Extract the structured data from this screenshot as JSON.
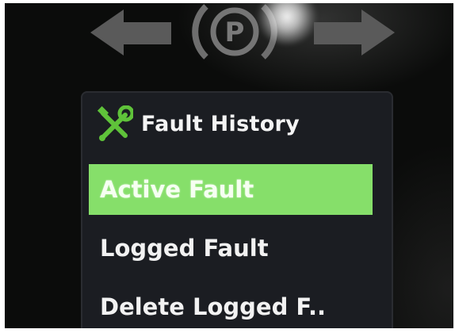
{
  "indicators": {
    "left_arrow": "left-arrow-icon",
    "park_brake": "parking-brake-icon",
    "park_brake_letter": "P",
    "right_arrow": "right-arrow-icon"
  },
  "menu": {
    "icon": "tools-icon",
    "title": "Fault History",
    "items": [
      {
        "label": "Active Fault",
        "selected": true
      },
      {
        "label": "Logged Fault",
        "selected": false
      },
      {
        "label": "Delete Logged F..",
        "selected": false
      }
    ]
  },
  "colors": {
    "selection_highlight": "#86df6a",
    "icon_green": "#5fc23a",
    "screen_background": "#1b1d22",
    "indicator_gray": "#6b6b6b"
  }
}
